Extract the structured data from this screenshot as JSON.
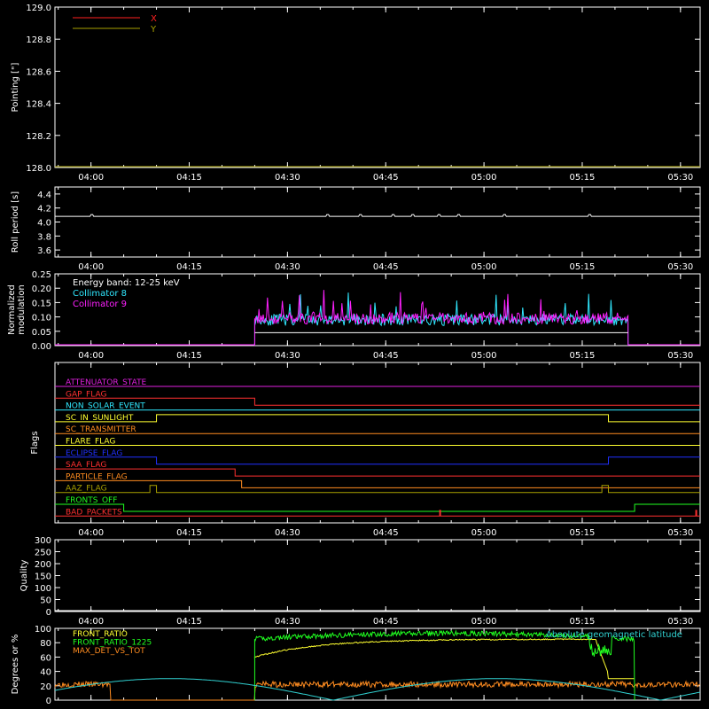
{
  "colors": {
    "background": "#000000",
    "axis": "#ffffff",
    "x": "#ff2020",
    "y": "#a8a000",
    "cyan": "#30e8ff",
    "magenta": "#ff20ff",
    "green": "#20ff20",
    "yellow": "#ffff30",
    "orange": "#ff8c20",
    "lat": "#30d0d0"
  },
  "x_ticks": [
    "04:00",
    "04:15",
    "04:30",
    "04:45",
    "05:00",
    "05:15",
    "05:30"
  ],
  "chart_data": [
    {
      "id": "pointing",
      "type": "line",
      "ylabel": "Pointing [\"]",
      "ylim": [
        128.0,
        129.0
      ],
      "yticks": [
        "129.0",
        "128.8",
        "128.6",
        "128.4",
        "128.2",
        "128.0"
      ],
      "legend": [
        "X",
        "Y"
      ],
      "series": [
        {
          "name": "X",
          "color": "#ff2020",
          "values": []
        },
        {
          "name": "Y",
          "color": "#a8a000",
          "values": []
        }
      ]
    },
    {
      "id": "roll",
      "type": "line",
      "ylabel": "Roll period [s]",
      "ylim": [
        3.5,
        4.5
      ],
      "yticks": [
        "4.4",
        "4.2",
        "4.0",
        "3.8",
        "3.6"
      ],
      "series": [
        {
          "name": "",
          "color": "#ffffff",
          "x": [
            "03:55",
            "05:33"
          ],
          "values": [
            4.08,
            4.08
          ]
        }
      ]
    },
    {
      "id": "modulation",
      "type": "line",
      "ylabel": "Normalized modulation",
      "ylim": [
        0,
        0.25
      ],
      "yticks": [
        "0.25",
        "0.20",
        "0.15",
        "0.10",
        "0.05",
        "0.00"
      ],
      "annotation": "Energy band: 12-25 keV",
      "legend": [
        "Collimator 8",
        "Collimator 9"
      ],
      "data_range": [
        "04:25",
        "05:22"
      ],
      "series": [
        {
          "name": "Collimator 8",
          "color": "#30e8ff",
          "mean": 0.09
        },
        {
          "name": "Collimator 9",
          "color": "#ff20ff",
          "mean": 0.095
        }
      ]
    },
    {
      "id": "flags",
      "type": "line",
      "ylabel": "Flags",
      "flags": [
        {
          "name": "ATTENUATOR_STATE",
          "color": "#e020e0",
          "steps": []
        },
        {
          "name": "GAP_FLAG",
          "color": "#ff3030",
          "steps": [
            [
              "04:25",
              -1
            ]
          ]
        },
        {
          "name": "NON_SOLAR_EVENT",
          "color": "#30e8ff",
          "steps": []
        },
        {
          "name": "SC_IN_SUNLIGHT",
          "color": "#ffff30",
          "steps": [
            [
              "04:10",
              1
            ],
            [
              "05:19",
              -1
            ]
          ]
        },
        {
          "name": "SC_TRANSMITTER",
          "color": "#ff8c20",
          "steps": []
        },
        {
          "name": "FLARE_FLAG",
          "color": "#ffff30",
          "steps": []
        },
        {
          "name": "ECLIPSE_FLAG",
          "color": "#2030ff",
          "steps": [
            [
              "04:10",
              -1
            ],
            [
              "05:19",
              1
            ]
          ]
        },
        {
          "name": "SAA_FLAG",
          "color": "#ff3030",
          "steps": [
            [
              "04:22",
              -1
            ]
          ]
        },
        {
          "name": "PARTICLE_FLAG",
          "color": "#ff8c20",
          "steps": [
            [
              "04:23",
              -1
            ]
          ]
        },
        {
          "name": "AAZ_FLAG",
          "color": "#a8a000",
          "steps": [
            [
              "04:09",
              1
            ],
            [
              "04:10",
              -1
            ],
            [
              "05:18",
              1
            ],
            [
              "05:19",
              -1
            ]
          ]
        },
        {
          "name": "FRONTS_OFF",
          "color": "#20ff20",
          "steps": [
            [
              "04:05",
              -1
            ],
            [
              "05:23",
              1
            ]
          ]
        },
        {
          "name": "BAD_PACKETS",
          "color": "#ff3030",
          "steps": []
        }
      ]
    },
    {
      "id": "quality",
      "type": "line",
      "ylabel": "Quality",
      "ylim": [
        0,
        300
      ],
      "yticks": [
        "300",
        "250",
        "200",
        "150",
        "100",
        "50",
        "0"
      ],
      "series": [
        {
          "name": "",
          "color": "#ffffff",
          "values": []
        }
      ]
    },
    {
      "id": "ratios",
      "type": "line",
      "ylabel": "Degrees or %",
      "ylim": [
        0,
        100
      ],
      "yticks": [
        "100",
        "80",
        "60",
        "40",
        "20",
        "0"
      ],
      "legend": [
        "FRONT_RATIO",
        "FRONT_RATIO_1225",
        "MAX_DET_VS_TOT"
      ],
      "annotation": "Absolute geomagnetic latitude",
      "series": [
        {
          "name": "FRONT_RATIO",
          "color": "#ffff30"
        },
        {
          "name": "FRONT_RATIO_1225",
          "color": "#20ff20"
        },
        {
          "name": "MAX_DET_VS_TOT",
          "color": "#ff8c20"
        },
        {
          "name": "Absolute geomagnetic latitude",
          "color": "#30d0d0"
        }
      ]
    }
  ]
}
